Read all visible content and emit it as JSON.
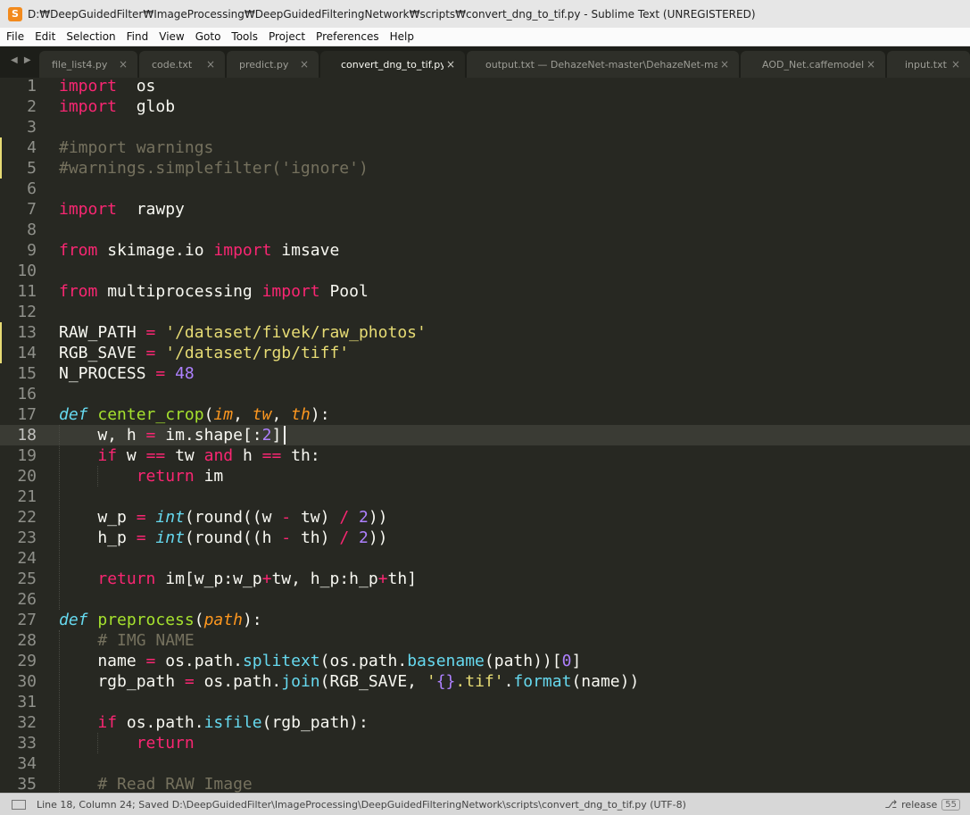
{
  "window": {
    "app_icon": "S",
    "title": "D:₩DeepGuidedFilter₩ImageProcessing₩DeepGuidedFilteringNetwork₩scripts₩convert_dng_to_tif.py - Sublime Text (UNREGISTERED)"
  },
  "menu": [
    "File",
    "Edit",
    "Selection",
    "Find",
    "View",
    "Goto",
    "Tools",
    "Project",
    "Preferences",
    "Help"
  ],
  "tab_nav_icon": "◀ ▶",
  "tabs": [
    {
      "label": "file_list4.py",
      "close": "×",
      "active": false
    },
    {
      "label": "code.txt",
      "close": "×",
      "active": false
    },
    {
      "label": "predict.py",
      "close": "×",
      "active": false
    },
    {
      "label": "convert_dng_to_tif.py",
      "close": "×",
      "active": true
    },
    {
      "label": "output.txt — DehazeNet-master\\DehazeNet-master",
      "close": "×",
      "active": false
    },
    {
      "label": "AOD_Net.caffemodel",
      "close": "×",
      "active": false
    },
    {
      "label": "input.txt",
      "close": "×",
      "active": false
    }
  ],
  "editor": {
    "current_line": 18,
    "modified_lines": [
      4,
      5,
      13,
      14
    ],
    "lines": [
      [
        [
          "kw",
          "import"
        ],
        [
          "",
          "  os"
        ]
      ],
      [
        [
          "kw",
          "import"
        ],
        [
          "",
          "  glob"
        ]
      ],
      [],
      [
        [
          "cm",
          "#import warnings"
        ]
      ],
      [
        [
          "cm",
          "#warnings.simplefilter('ignore')"
        ]
      ],
      [],
      [
        [
          "kw",
          "import"
        ],
        [
          "",
          "  rawpy"
        ]
      ],
      [],
      [
        [
          "kw",
          "from"
        ],
        [
          "",
          " skimage.io "
        ],
        [
          "kw",
          "import"
        ],
        [
          "",
          " imsave"
        ]
      ],
      [],
      [
        [
          "kw",
          "from"
        ],
        [
          "",
          " multiprocessing "
        ],
        [
          "kw",
          "import"
        ],
        [
          "",
          " Pool"
        ]
      ],
      [],
      [
        [
          "",
          "RAW_PATH "
        ],
        [
          "op",
          "="
        ],
        [
          "",
          " "
        ],
        [
          "st",
          "'/dataset/fivek/raw_photos'"
        ]
      ],
      [
        [
          "",
          "RGB_SAVE "
        ],
        [
          "op",
          "="
        ],
        [
          "",
          " "
        ],
        [
          "st",
          "'/dataset/rgb/tiff'"
        ]
      ],
      [
        [
          "",
          "N_PROCESS "
        ],
        [
          "op",
          "="
        ],
        [
          "",
          " "
        ],
        [
          "nu",
          "48"
        ]
      ],
      [],
      [
        [
          "df",
          "def"
        ],
        [
          "",
          " "
        ],
        [
          "fn",
          "center_crop"
        ],
        [
          "",
          "("
        ],
        [
          "pa",
          "im"
        ],
        [
          "",
          ", "
        ],
        [
          "pa",
          "tw"
        ],
        [
          "",
          ", "
        ],
        [
          "pa",
          "th"
        ],
        [
          "",
          "):"
        ]
      ],
      [
        [
          "",
          "    w, h "
        ],
        [
          "op",
          "="
        ],
        [
          "",
          " im.shape[:"
        ],
        [
          "nu",
          "2"
        ],
        [
          "",
          "]"
        ]
      ],
      [
        [
          "",
          "    "
        ],
        [
          "kw",
          "if"
        ],
        [
          "",
          " w "
        ],
        [
          "op",
          "=="
        ],
        [
          "",
          " tw "
        ],
        [
          "kw",
          "and"
        ],
        [
          "",
          " h "
        ],
        [
          "op",
          "=="
        ],
        [
          "",
          " th:"
        ]
      ],
      [
        [
          "",
          "        "
        ],
        [
          "kw",
          "return"
        ],
        [
          "",
          " im"
        ]
      ],
      [],
      [
        [
          "",
          "    w_p "
        ],
        [
          "op",
          "="
        ],
        [
          "",
          " "
        ],
        [
          "bii",
          "int"
        ],
        [
          "",
          "(round((w "
        ],
        [
          "op",
          "-"
        ],
        [
          "",
          " tw) "
        ],
        [
          "op",
          "/"
        ],
        [
          "",
          " "
        ],
        [
          "nu",
          "2"
        ],
        [
          "",
          "))"
        ]
      ],
      [
        [
          "",
          "    h_p "
        ],
        [
          "op",
          "="
        ],
        [
          "",
          " "
        ],
        [
          "bii",
          "int"
        ],
        [
          "",
          "(round((h "
        ],
        [
          "op",
          "-"
        ],
        [
          "",
          " th) "
        ],
        [
          "op",
          "/"
        ],
        [
          "",
          " "
        ],
        [
          "nu",
          "2"
        ],
        [
          "",
          "))"
        ]
      ],
      [],
      [
        [
          "",
          "    "
        ],
        [
          "kw",
          "return"
        ],
        [
          "",
          " im[w_p:w_p"
        ],
        [
          "op",
          "+"
        ],
        [
          "",
          "tw, h_p:h_p"
        ],
        [
          "op",
          "+"
        ],
        [
          "",
          "th]"
        ]
      ],
      [],
      [
        [
          "df",
          "def"
        ],
        [
          "",
          " "
        ],
        [
          "fn",
          "preprocess"
        ],
        [
          "",
          "("
        ],
        [
          "pa",
          "path"
        ],
        [
          "",
          "):"
        ]
      ],
      [
        [
          "",
          "    "
        ],
        [
          "cm",
          "# IMG NAME"
        ]
      ],
      [
        [
          "",
          "    name "
        ],
        [
          "op",
          "="
        ],
        [
          "",
          " os.path."
        ],
        [
          "bi",
          "splitext"
        ],
        [
          "",
          "(os.path."
        ],
        [
          "bi",
          "basename"
        ],
        [
          "",
          "(path))["
        ],
        [
          "nu",
          "0"
        ],
        [
          "",
          "]"
        ]
      ],
      [
        [
          "",
          "    rgb_path "
        ],
        [
          "op",
          "="
        ],
        [
          "",
          " os.path."
        ],
        [
          "bi",
          "join"
        ],
        [
          "",
          "(RGB_SAVE, "
        ],
        [
          "st",
          "'"
        ],
        [
          "nu",
          "{}"
        ],
        [
          "st",
          ".tif'"
        ],
        [
          "",
          "."
        ],
        [
          "bi",
          "format"
        ],
        [
          "",
          "(name))"
        ]
      ],
      [],
      [
        [
          "",
          "    "
        ],
        [
          "kw",
          "if"
        ],
        [
          "",
          " os.path."
        ],
        [
          "bi",
          "isfile"
        ],
        [
          "",
          "(rgb_path):"
        ]
      ],
      [
        [
          "",
          "        "
        ],
        [
          "kw",
          "return"
        ]
      ],
      [],
      [
        [
          "",
          "    "
        ],
        [
          "cm",
          "# Read RAW Image"
        ]
      ]
    ]
  },
  "status": {
    "text": "Line 18, Column 24; Saved D:\\DeepGuidedFilter\\ImageProcessing\\DeepGuidedFilteringNetwork\\scripts\\convert_dng_to_tif.py (UTF-8)",
    "branch_icon": "branch-icon",
    "branch": "release",
    "count": "55"
  }
}
